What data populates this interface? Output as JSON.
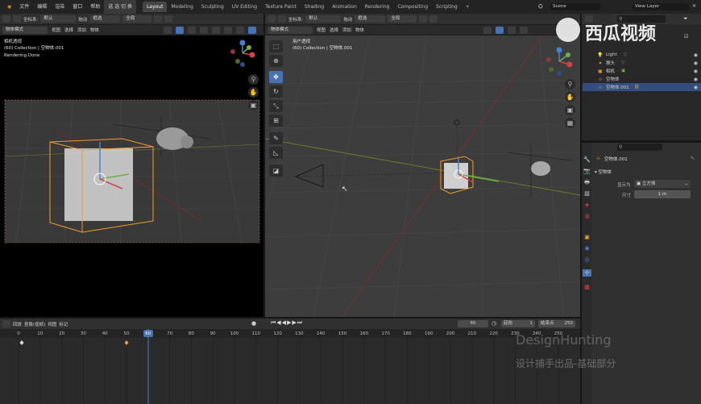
{
  "menubar": {
    "items": [
      "文件",
      "编辑",
      "渲染",
      "窗口",
      "帮助"
    ],
    "quick_tab": "选 选 切 换",
    "workspaces": [
      "Layout",
      "Modeling",
      "Sculpting",
      "UV Editing",
      "Texture Paint",
      "Shading",
      "Animation",
      "Rendering",
      "Compositing",
      "Scripting"
    ],
    "add_tab": "+",
    "scene": "Scene",
    "view_layer": "View Layer"
  },
  "left_viewport": {
    "header": {
      "orientation_label": "坐标系:",
      "orientation_value": "默认",
      "drag_label": "拖动",
      "select_value": "框选",
      "pivot_value": "全局"
    },
    "header2": {
      "mode": "物体模式",
      "menus": [
        "视图",
        "选择",
        "添加",
        "物体"
      ]
    },
    "overlay": {
      "title": "相机透视",
      "collection": "(60) Collection | 空物体.001",
      "status": "Rendering Done"
    }
  },
  "right_viewport": {
    "header": {
      "orientation_label": "坐标系:",
      "orientation_value": "默认",
      "drag_label": "拖动",
      "select_value": "框选",
      "pivot_value": "全局"
    },
    "header2": {
      "mode": "物体模式",
      "menus": [
        "视图",
        "选择",
        "添加",
        "物体"
      ]
    },
    "overlay": {
      "title": "用户透视",
      "collection": "(60) Collection | 空物体.001"
    }
  },
  "outliner": {
    "items": [
      {
        "icon": "▾",
        "label": "Light",
        "color": "#e8a33c",
        "eye": "◉"
      },
      {
        "icon": "▾",
        "label": "猴头",
        "color": "#e8a33c",
        "eye": "◉"
      },
      {
        "icon": "▾",
        "label": "相机",
        "color": "#e8a33c",
        "eye": "◉"
      },
      {
        "icon": "⊹",
        "label": "空物体",
        "color": "#e8a33c",
        "eye": "◉"
      },
      {
        "icon": "⊹",
        "label": "空物体.001",
        "color": "#e8a33c",
        "eye": "◉"
      }
    ]
  },
  "properties": {
    "object_name": "空物体.001",
    "section": "空物体",
    "display_as_label": "显示为",
    "display_as_value": "立方体",
    "size_label": "尺寸",
    "size_value": "1 m"
  },
  "timeline": {
    "header_items": [
      "回放",
      "抠像(插帧)",
      "视图",
      "标记"
    ],
    "current_frame": "60",
    "start_label": "起始",
    "start_value": "1",
    "end_label": "结束点",
    "end_value": "250",
    "ticks": [
      "0",
      "10",
      "20",
      "30",
      "40",
      "50",
      "60",
      "70",
      "80",
      "90",
      "100",
      "110",
      "120",
      "130",
      "140",
      "150",
      "160",
      "170",
      "180",
      "190",
      "200",
      "210",
      "220",
      "230",
      "240",
      "250"
    ]
  },
  "watermark": {
    "logo_text": "西瓜视频",
    "brand": "DesignHunting",
    "subtitle": "设计捕手出品-基础部分"
  },
  "colors": {
    "accent": "#4772b3",
    "x_axis": "#c8474f",
    "y_axis": "#7a9e2f",
    "z_axis": "#4a7fd6",
    "selection": "#f59a29"
  }
}
